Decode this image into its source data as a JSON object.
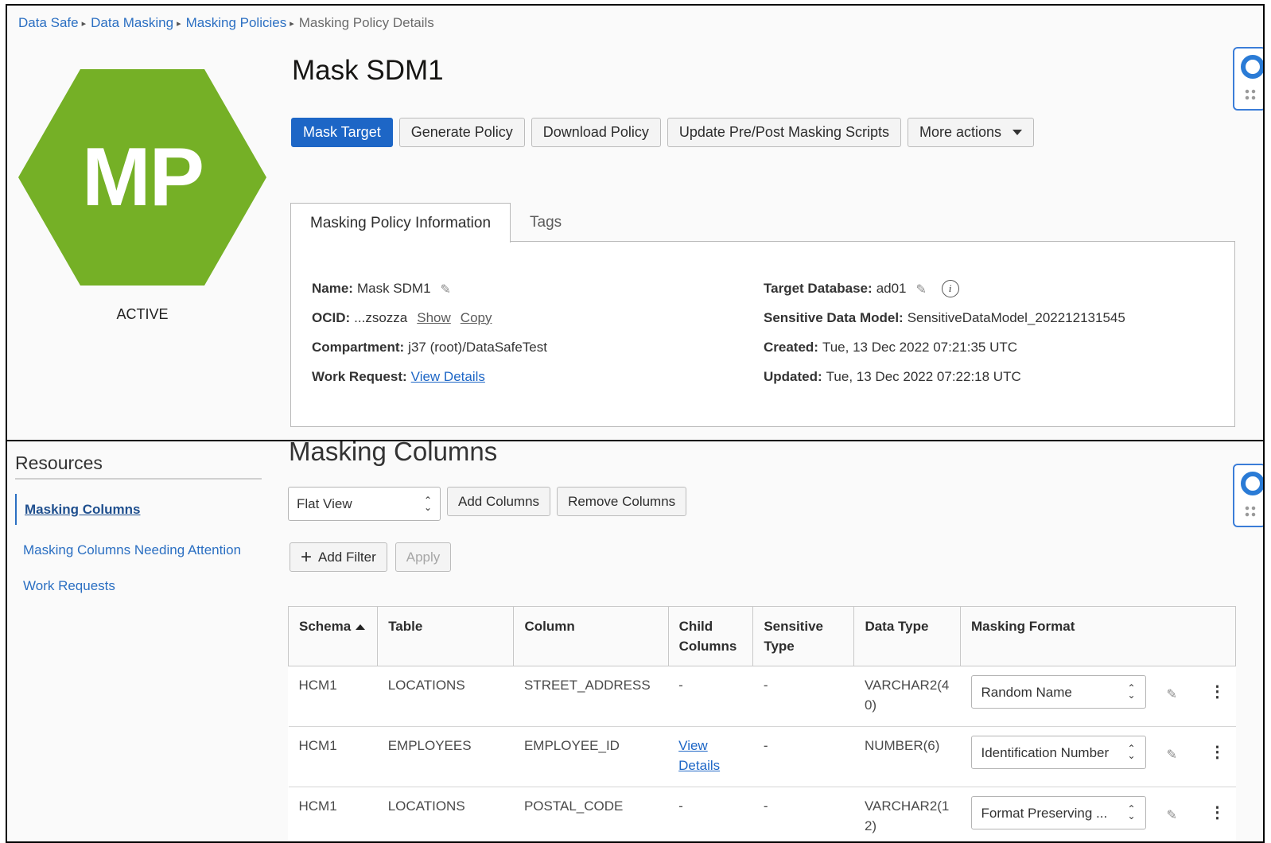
{
  "breadcrumb": [
    "Data Safe",
    "Data Masking",
    "Masking Policies",
    "Masking Policy Details"
  ],
  "badge": {
    "initials": "MP",
    "color": "#75b026",
    "status": "ACTIVE"
  },
  "title": "Mask SDM1",
  "actions": {
    "mask_target": "Mask Target",
    "generate_policy": "Generate Policy",
    "download_policy": "Download Policy",
    "update_scripts": "Update Pre/Post Masking Scripts",
    "more_actions": "More actions"
  },
  "tabs": {
    "info": "Masking Policy Information",
    "tags": "Tags"
  },
  "info": {
    "name_label": "Name:",
    "name_value": "Mask SDM1",
    "ocid_label": "OCID:",
    "ocid_value": "...zsozza",
    "ocid_show": "Show",
    "ocid_copy": "Copy",
    "compartment_label": "Compartment:",
    "compartment_value": "j37 (root)/DataSafeTest",
    "work_request_label": "Work Request:",
    "work_request_link": "View Details",
    "target_db_label": "Target Database:",
    "target_db_value": "ad01",
    "sdm_label": "Sensitive Data Model:",
    "sdm_value": "SensitiveDataModel_202212131545",
    "created_label": "Created:",
    "created_value": "Tue, 13 Dec 2022 07:21:35 UTC",
    "updated_label": "Updated:",
    "updated_value": "Tue, 13 Dec 2022 07:22:18 UTC"
  },
  "resources": {
    "title": "Resources",
    "items": [
      "Masking Columns",
      "Masking Columns Needing Attention",
      "Work Requests"
    ]
  },
  "masking_columns": {
    "title": "Masking Columns",
    "view_select": "Flat View",
    "add_columns": "Add Columns",
    "remove_columns": "Remove Columns",
    "add_filter": "Add Filter",
    "apply": "Apply",
    "headers": [
      "Schema",
      "Table",
      "Column",
      "Child Columns",
      "Sensitive Type",
      "Data Type",
      "Masking Format"
    ],
    "rows": [
      {
        "schema": "HCM1",
        "table": "LOCATIONS",
        "column": "STREET_ADDRESS",
        "child": "-",
        "sensitive": "-",
        "datatype": "VARCHAR2(40)",
        "format": "Random Name"
      },
      {
        "schema": "HCM1",
        "table": "EMPLOYEES",
        "column": "EMPLOYEE_ID",
        "child": "View Details",
        "sensitive": "-",
        "datatype": "NUMBER(6)",
        "format": "Identification Number"
      },
      {
        "schema": "HCM1",
        "table": "LOCATIONS",
        "column": "POSTAL_CODE",
        "child": "-",
        "sensitive": "-",
        "datatype": "VARCHAR2(12)",
        "format": "Format Preserving ..."
      }
    ]
  }
}
